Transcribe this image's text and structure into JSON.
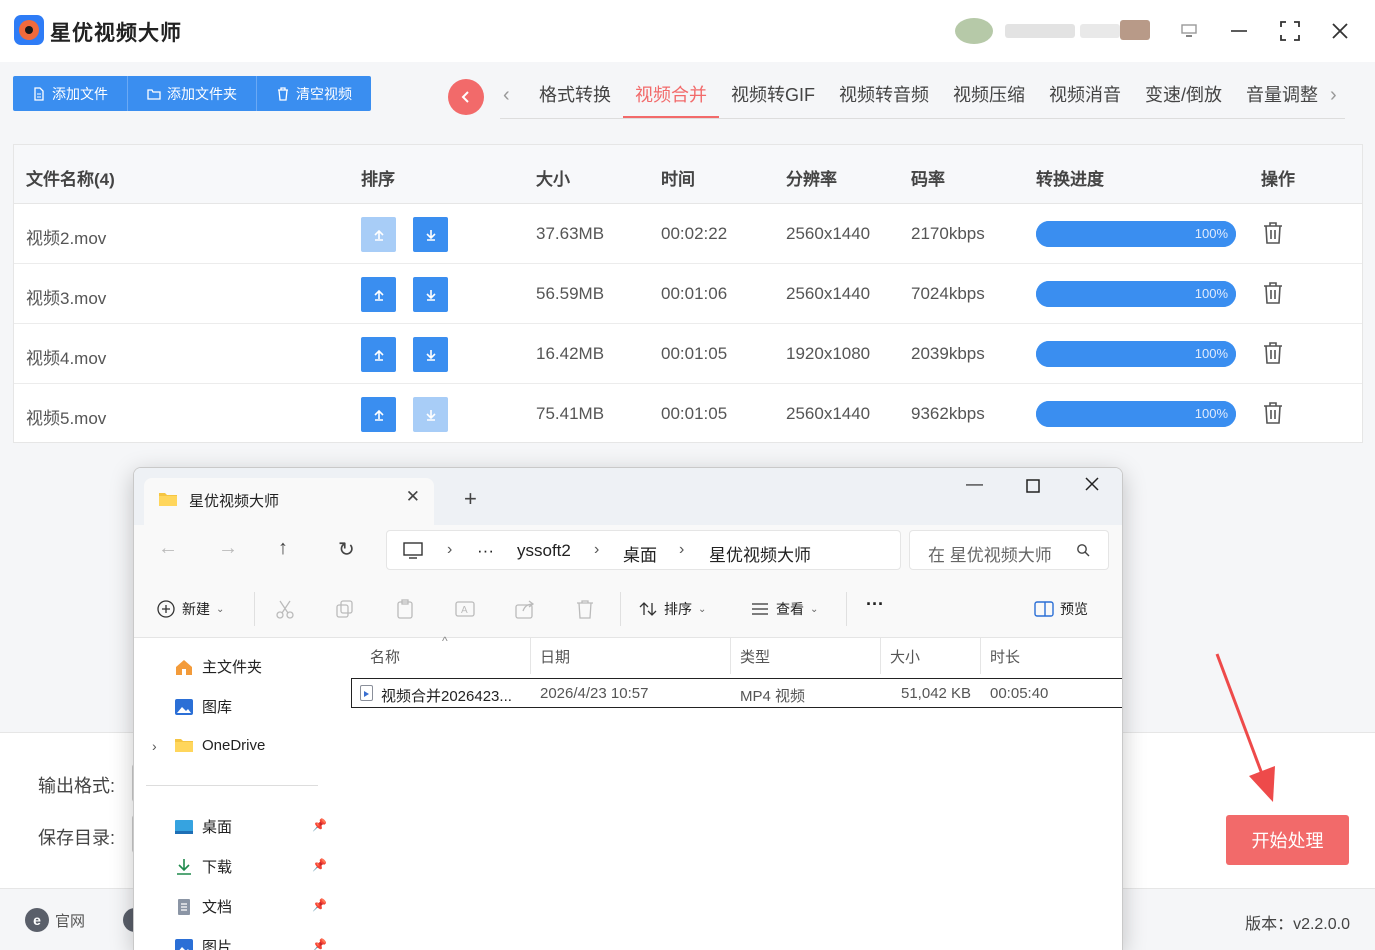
{
  "app": {
    "title": "星优视频大师"
  },
  "toolbar": {
    "add_file": "添加文件",
    "add_folder": "添加文件夹",
    "clear": "清空视频"
  },
  "tabs": [
    "格式转换",
    "视频合并",
    "视频转GIF",
    "视频转音频",
    "视频压缩",
    "视频消音",
    "变速/倒放",
    "音量调整"
  ],
  "active_tab": "视频合并",
  "table": {
    "headers": [
      "文件名称(4)",
      "排序",
      "大小",
      "时间",
      "分辨率",
      "码率",
      "转换进度",
      "操作"
    ],
    "rows": [
      {
        "name": "视频2.mov",
        "size": "37.63MB",
        "time": "00:02:22",
        "resolution": "2560x1440",
        "bitrate": "2170kbps",
        "progress_label": "100%",
        "progress": 1.0
      },
      {
        "name": "视频3.mov",
        "size": "56.59MB",
        "time": "00:01:06",
        "resolution": "2560x1440",
        "bitrate": "7024kbps",
        "progress_label": "100%",
        "progress": 1.0
      },
      {
        "name": "视频4.mov",
        "size": "16.42MB",
        "time": "00:01:05",
        "resolution": "1920x1080",
        "bitrate": "2039kbps",
        "progress_label": "100%",
        "progress": 1.0
      },
      {
        "name": "视频5.mov",
        "size": "75.41MB",
        "time": "00:01:05",
        "resolution": "2560x1440",
        "bitrate": "9362kbps",
        "progress_label": "100%",
        "progress": 1.0
      }
    ]
  },
  "bottom": {
    "output_format_label": "输出格式:",
    "save_dir_label": "保存目录:",
    "start_button": "开始处理"
  },
  "footer": {
    "site_label": "官网",
    "version": "版本：v2.2.0.0"
  },
  "explorer": {
    "tab_title": "星优视频大师",
    "breadcrumbs": [
      "yssoft2",
      "桌面",
      "星优视频大师"
    ],
    "ellipsis": "···",
    "search_placeholder": "在 星优视频大师",
    "commands": {
      "new": "新建",
      "sort": "排序",
      "view": "查看",
      "more": "···",
      "preview": "预览"
    },
    "sidebar": {
      "home": "主文件夹",
      "gallery": "图库",
      "onedrive": "OneDrive",
      "desktop": "桌面",
      "downloads": "下载",
      "documents": "文档",
      "pictures": "图片"
    },
    "columns": [
      "名称",
      "日期",
      "类型",
      "大小",
      "时长"
    ],
    "files": [
      {
        "name": "视频合并2026423...",
        "date": "2026/4/23 10:57",
        "type": "MP4 视频",
        "size": "51,042 KB",
        "duration": "00:05:40"
      }
    ]
  },
  "colors": {
    "accent_blue": "#3a8ef0",
    "accent_red": "#f26a6a"
  }
}
